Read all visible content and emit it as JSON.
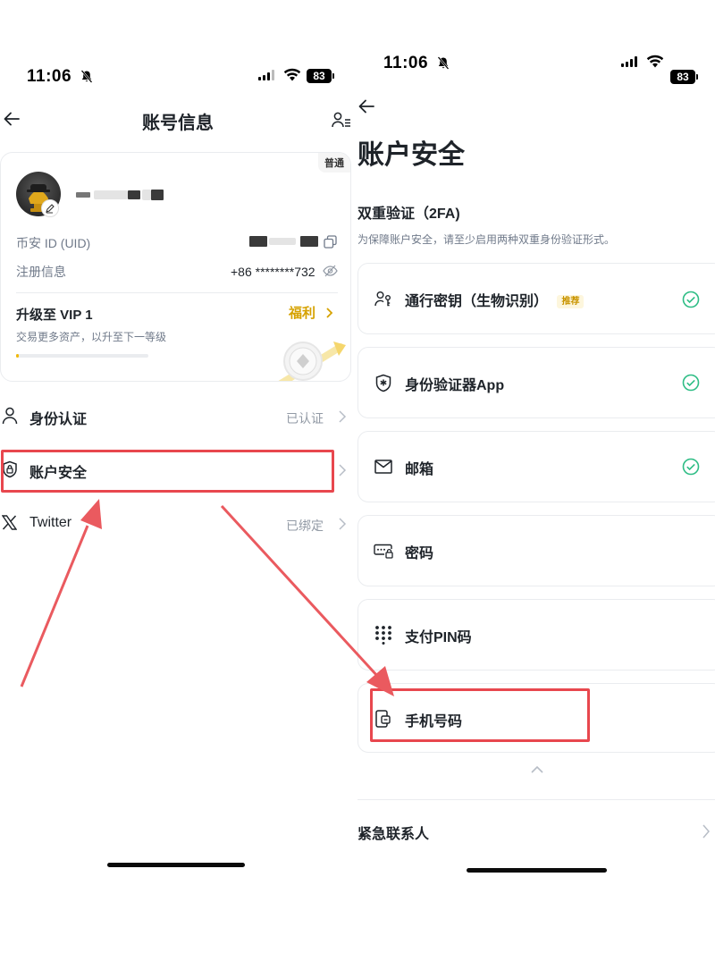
{
  "left": {
    "status": {
      "time": "11:06",
      "battery": "83"
    },
    "nav": {
      "title": "账号信息"
    },
    "profile": {
      "tag": "普通",
      "uid_label": "币安 ID (UID)",
      "reg_label": "注册信息",
      "reg_value": "+86 ********732",
      "vip_title": "升级至 VIP 1",
      "vip_link": "福利",
      "vip_sub": "交易更多资产，以升至下一等级"
    },
    "menu": [
      {
        "label": "身份认证",
        "status": "已认证",
        "icon": "user-icon"
      },
      {
        "label": "账户安全",
        "status": "",
        "icon": "shield-lock-icon"
      },
      {
        "label": "Twitter",
        "status": "已绑定",
        "icon": "x-logo-icon"
      }
    ]
  },
  "right": {
    "status": {
      "time": "11:06",
      "battery": "83"
    },
    "title": "账户安全",
    "section_title": "双重验证（2FA)",
    "section_sub": "为保障账户安全，请至少启用两种双重身份验证形式。",
    "options": [
      {
        "label": "通行密钥（生物识别）",
        "badge": "推荐",
        "enabled": true,
        "icon": "passkey-icon"
      },
      {
        "label": "身份验证器App",
        "enabled": true,
        "icon": "authenticator-icon"
      },
      {
        "label": "邮箱",
        "enabled": true,
        "icon": "mail-icon"
      },
      {
        "label": "密码",
        "enabled": false,
        "icon": "password-icon"
      },
      {
        "label": "支付PIN码",
        "enabled": false,
        "icon": "keypad-icon"
      },
      {
        "label": "手机号码",
        "enabled": false,
        "icon": "phone-icon"
      }
    ],
    "emergency_label": "紧急联系人"
  },
  "colors": {
    "accent": "#f0b90b",
    "link_gold": "#d6a200",
    "check_green": "#2ebd85",
    "highlight_red": "#e8474e",
    "text": "#1e2329",
    "muted": "#707a8a"
  }
}
